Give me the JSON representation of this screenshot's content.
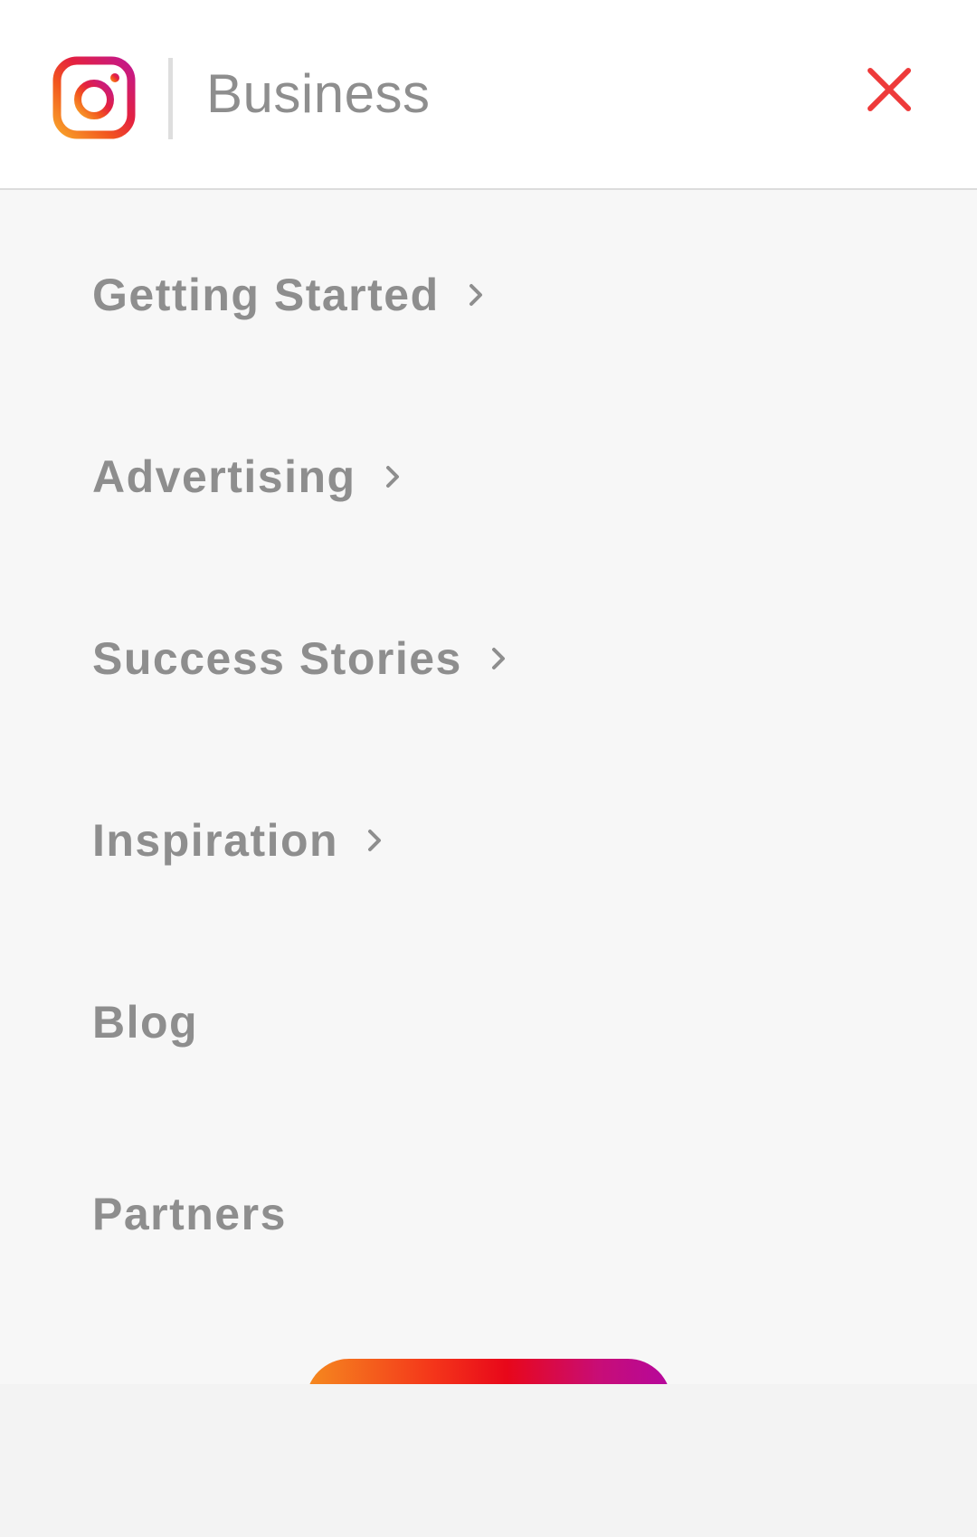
{
  "header": {
    "brand_label": "Business",
    "logo_icon": "instagram-logo-icon",
    "close_icon": "close-icon",
    "close_color": "#ee3a3a"
  },
  "menu": {
    "items": [
      {
        "label": "Getting Started",
        "has_chevron": true
      },
      {
        "label": "Advertising",
        "has_chevron": true
      },
      {
        "label": "Success Stories",
        "has_chevron": true
      },
      {
        "label": "Inspiration",
        "has_chevron": true
      },
      {
        "label": "Blog",
        "has_chevron": false
      },
      {
        "label": "Partners",
        "has_chevron": false
      }
    ]
  },
  "colors": {
    "menu_text": "#8e8e8e",
    "background": "#f7f7f7",
    "cta_gradient": [
      "#f58a1f",
      "#e8071a",
      "#b5079d"
    ]
  }
}
